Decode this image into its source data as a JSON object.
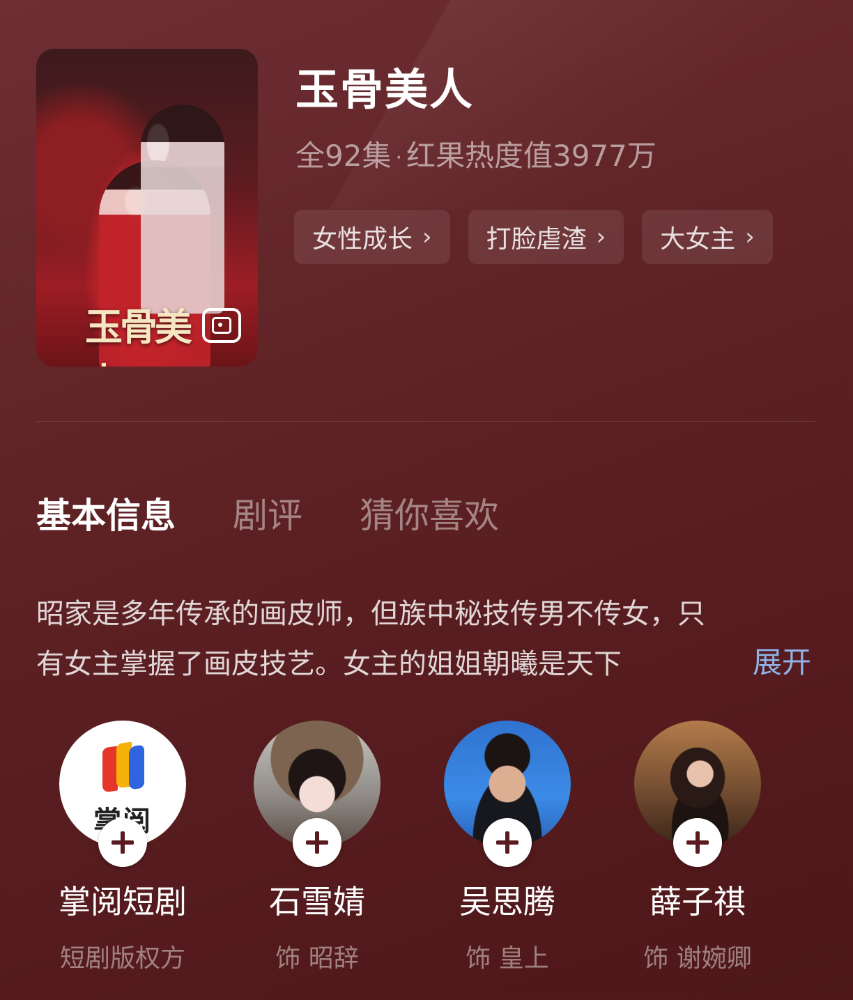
{
  "drama": {
    "title": "玉骨美人",
    "poster_title": "玉骨美人",
    "episodes": "全92集",
    "separator": "·",
    "heat": "红果热度值3977万",
    "tags": [
      "女性成长",
      "打脸虐渣",
      "大女主"
    ]
  },
  "tabs": {
    "items": [
      "基本信息",
      "剧评",
      "猜你喜欢"
    ],
    "active": "基本信息"
  },
  "synopsis": {
    "line1": "昭家是多年传承的画皮师，但族中秘技传男不传女，只",
    "line2": "有女主掌握了画皮技艺。女主的姐姐朝曦是天下",
    "expand_label": "展开"
  },
  "cast": [
    {
      "name": "掌阅短剧",
      "role": "短剧版权方",
      "logo_text": "掌阅",
      "avatar_icon": "zhangyue-logo-icon"
    },
    {
      "name": "石雪婧",
      "role": "饰 昭辞",
      "avatar_icon": "actor-avatar"
    },
    {
      "name": "吴思腾",
      "role": "饰 皇上",
      "avatar_icon": "actor-avatar"
    },
    {
      "name": "薛子祺",
      "role": "饰 谢婉卿",
      "avatar_icon": "actor-avatar"
    }
  ],
  "colors": {
    "background": "#5e2125",
    "expand_link": "#8fb3e8",
    "plus_icon": "#5a1b1f"
  }
}
